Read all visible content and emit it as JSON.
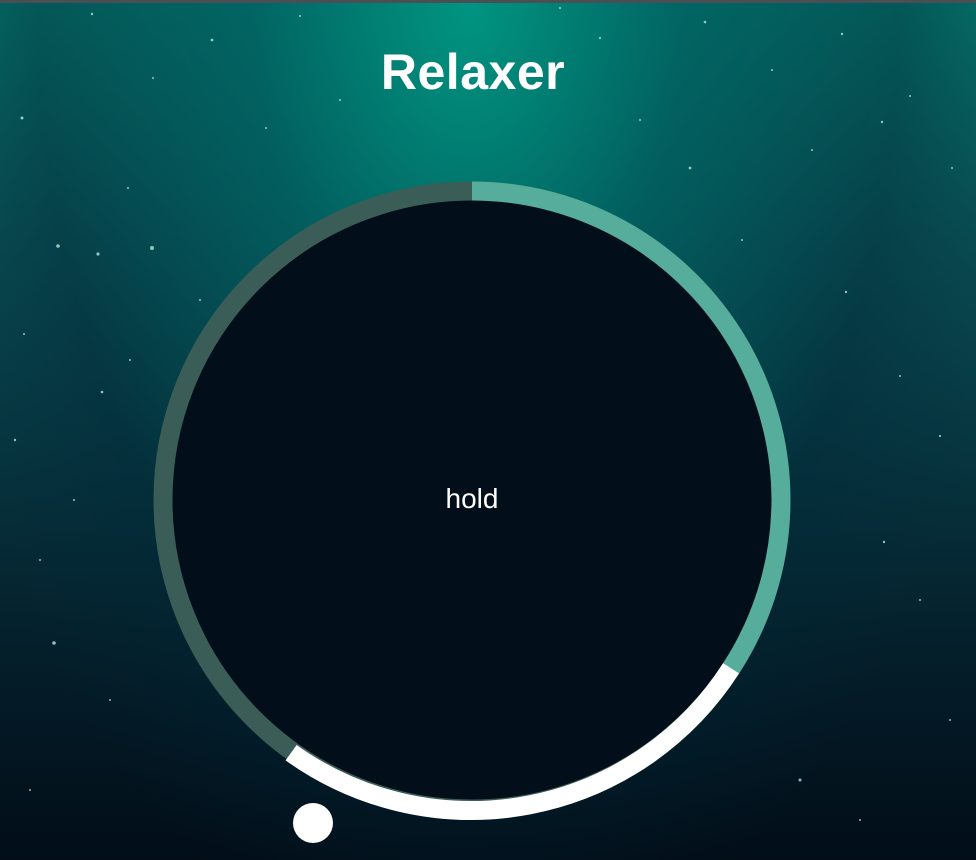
{
  "app": {
    "title": "Relaxer"
  },
  "breathing": {
    "phase_label": "hold"
  },
  "colors": {
    "ring_track": "#3a5e57",
    "ring_breathe_in": "#57ad9b",
    "ring_hold": "#ffffff",
    "circle_fill": "#020e19",
    "text": "#ffffff"
  }
}
